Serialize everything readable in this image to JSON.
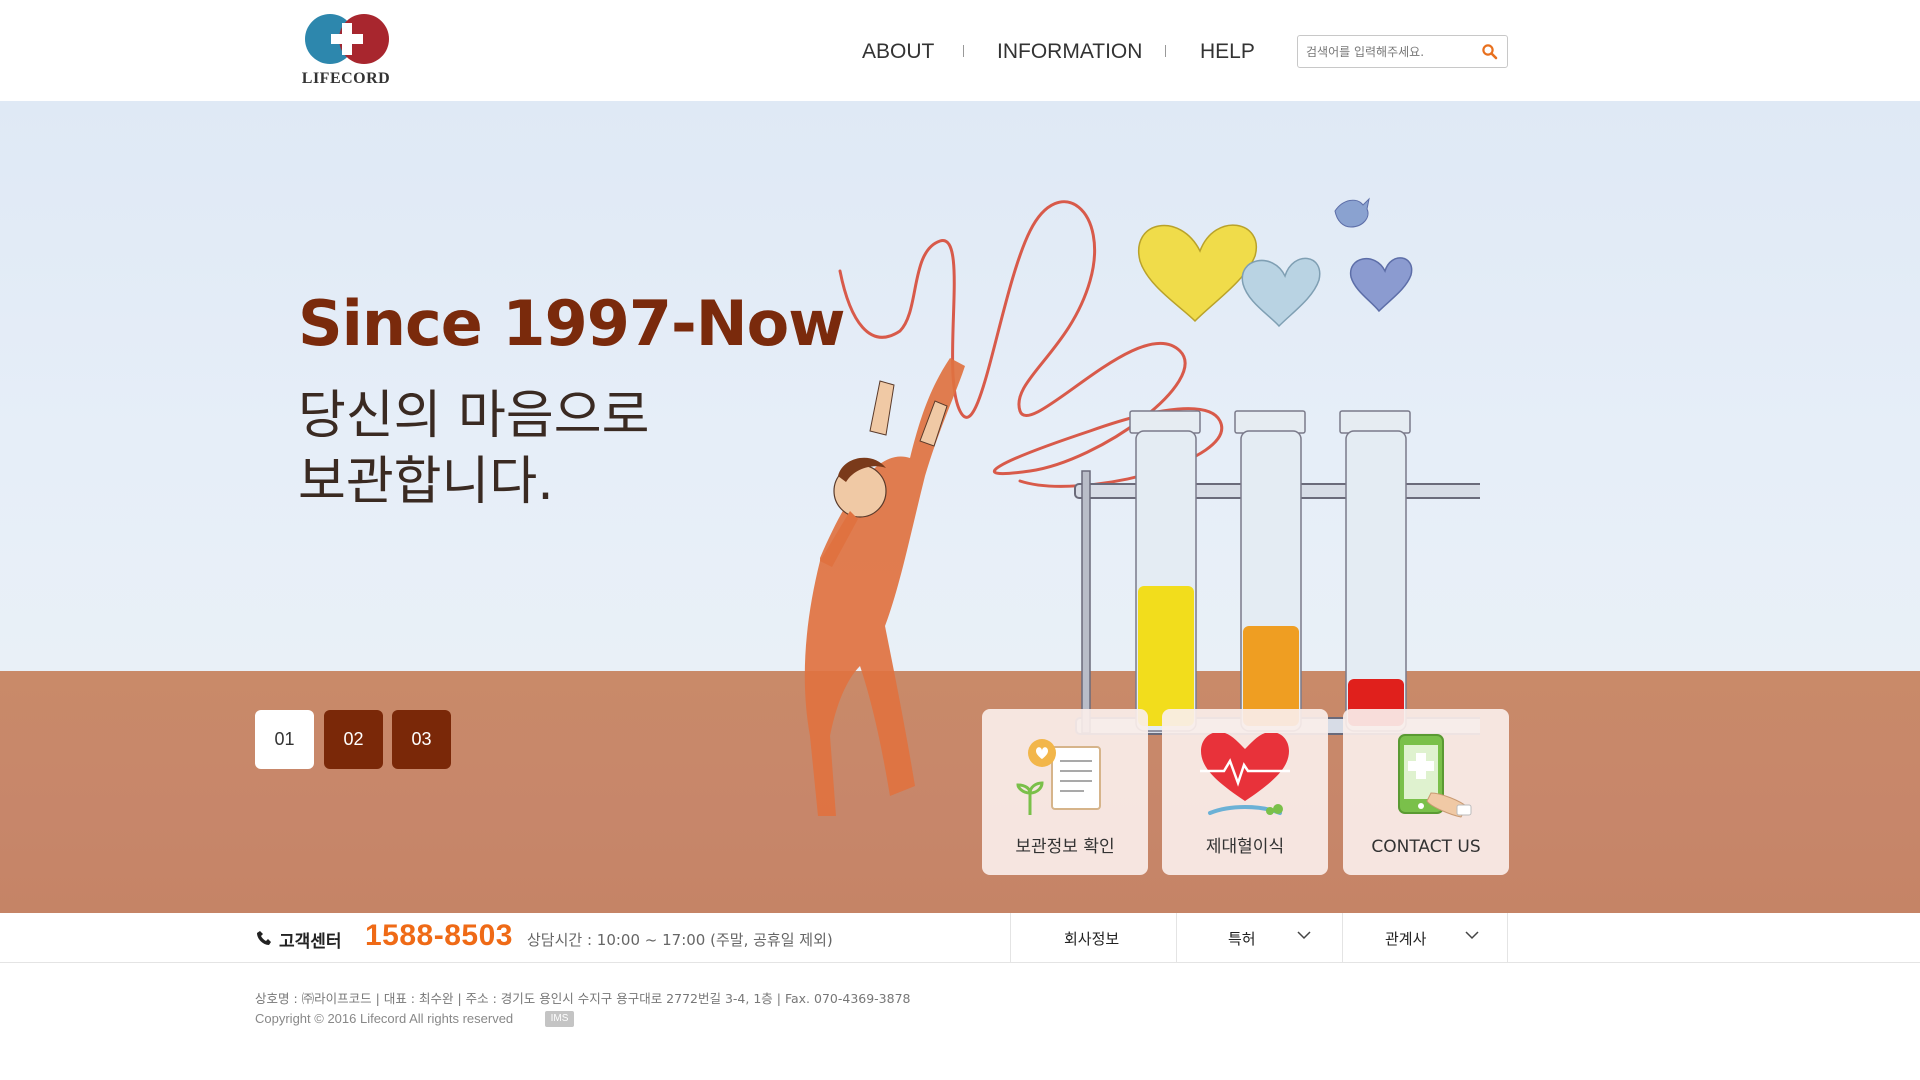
{
  "brand": {
    "name": "LIFECORD"
  },
  "nav": [
    {
      "label": "ABOUT"
    },
    {
      "label": "INFORMATION"
    },
    {
      "label": "HELP"
    }
  ],
  "search": {
    "placeholder": "검색어를 입력해주세요.",
    "icon": "search-icon"
  },
  "hero": {
    "title": "Since 1997-Now",
    "subtitle_line1": "당신의 마음으로",
    "subtitle_line2": "보관합니다."
  },
  "pager": [
    {
      "label": "01",
      "active": true
    },
    {
      "label": "02",
      "active": false
    },
    {
      "label": "03",
      "active": false
    }
  ],
  "quick_links": [
    {
      "label": "보관정보 확인",
      "icon": "document-icon"
    },
    {
      "label": "제대혈이식",
      "icon": "heart-icon"
    },
    {
      "label": "CONTACT US",
      "icon": "phone-icon"
    }
  ],
  "footer_bar": {
    "cs_label": "고객센터",
    "phone": "1588-8503",
    "hours": "상담시간 : 10:00 ~ 17:00 (주말, 공휴일 제외)",
    "menus": [
      {
        "label": "회사정보"
      },
      {
        "label": "특허"
      },
      {
        "label": "관계사"
      }
    ]
  },
  "footer": {
    "company_info": "상호명 : ㈜라이프코드  |  대표 : 최수완  |  주소 : 경기도 용인시 수지구 용구대로 2772번길 3-4, 1층  |  Fax. 070-4369-3878",
    "copyright": "Copyright © 2016 Lifecord All rights reserved",
    "badge": "IMS"
  },
  "colors": {
    "accent_orange": "#ef6a16",
    "title_brown": "#7a2a0c",
    "sky": "#e2ebf6",
    "ground": "#c98a69",
    "pager_dark": "#7a2808"
  }
}
